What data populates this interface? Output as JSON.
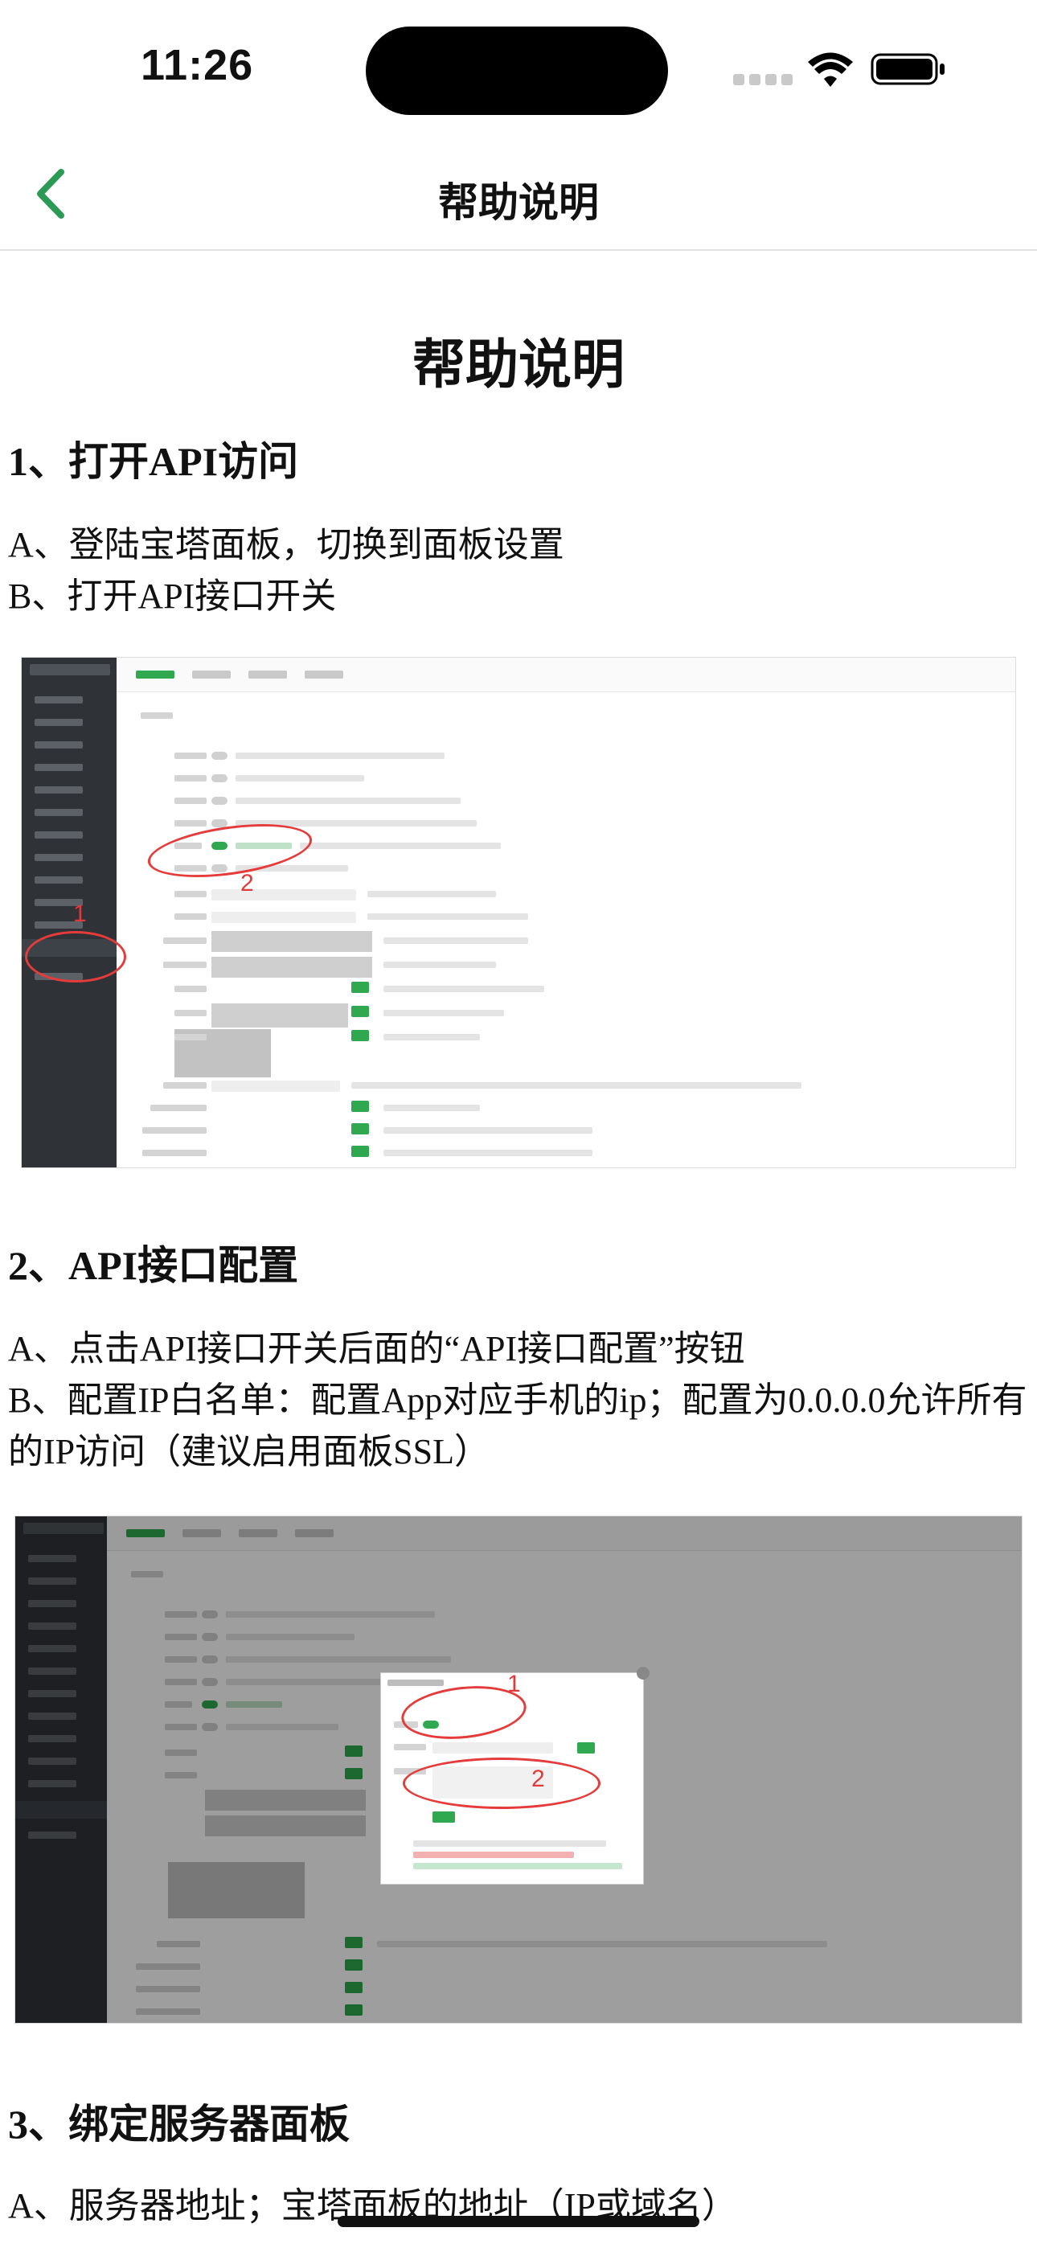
{
  "status_bar": {
    "time": "11:26"
  },
  "nav": {
    "title": "帮助说明"
  },
  "doc": {
    "title": "帮助说明",
    "sections": [
      {
        "heading": "1、打开API访问",
        "lines": [
          "A、登陆宝塔面板，切换到面板设置",
          "B、打开API接口开关"
        ],
        "figure_marks": [
          "1",
          "2"
        ]
      },
      {
        "heading": "2、API接口配置",
        "lines": [
          "A、点击API接口开关后面的“API接口配置”按钮",
          "B、配置IP白名单：配置App对应手机的ip；配置为0.0.0.0允许所有的IP访问（建议启用面板SSL）"
        ],
        "figure_marks": [
          "1",
          "2"
        ]
      },
      {
        "heading": "3、绑定服务器面板",
        "lines": [
          "A、服务器地址；宝塔面板的地址（IP或域名）"
        ]
      }
    ]
  },
  "colors": {
    "accent": "#2fa84f",
    "annotation": "#e53b3b"
  },
  "icons": {
    "back": "chevron-left-icon",
    "wifi": "wifi-icon",
    "battery": "battery-icon",
    "signal": "signal-icon"
  }
}
